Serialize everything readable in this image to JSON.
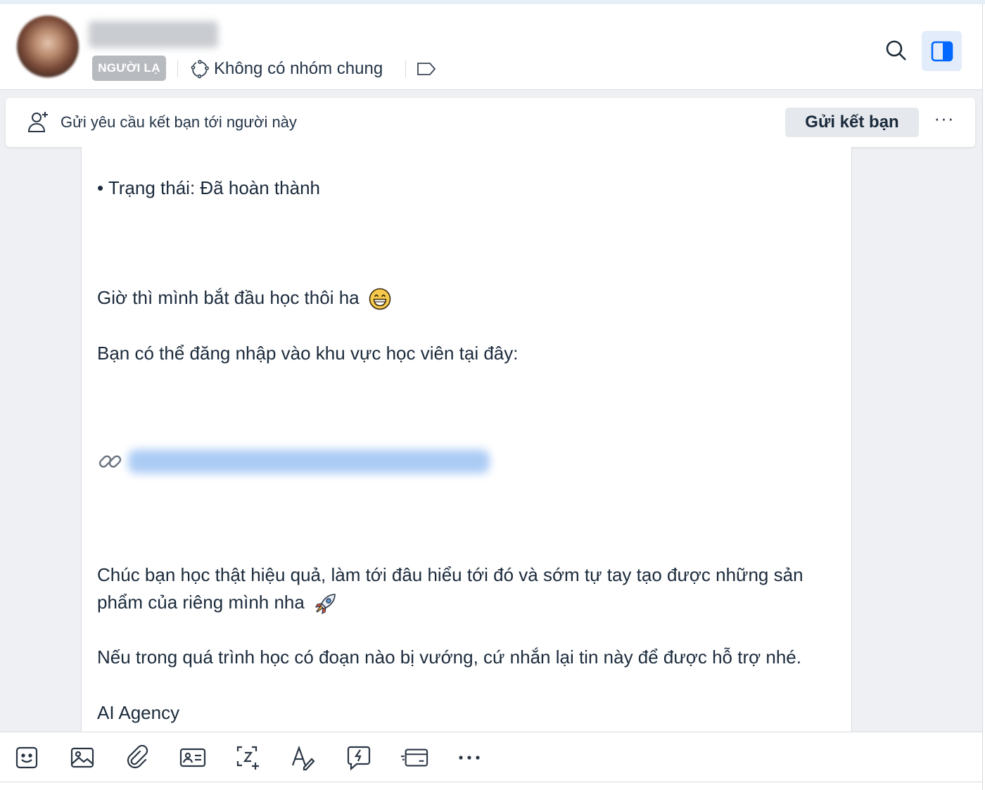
{
  "header": {
    "badge": "NGƯỜI LẠ",
    "groups_text": "Không có nhóm chung"
  },
  "friend_request": {
    "prompt": "Gửi yêu cầu kết bạn tới người này",
    "button": "Gửi kết bạn",
    "more": "···"
  },
  "message": {
    "status_line": "• Trạng thái: Đã hoàn thành",
    "start_line": "Giờ thì mình bắt đầu học thôi ha",
    "login_line": "Bạn có thể đăng nhập vào khu vực học viên tại đây:",
    "wish_line_1": "Chúc bạn học thật hiệu quả, làm tới đâu hiểu tới đó và sớm tự tay tạo được những sản",
    "wish_line_2": "phẩm của riêng mình nha",
    "support_line": "Nếu trong quá trình học có đoạn nào bị vướng, cứ nhắn lại tin này để được hỗ trợ nhé.",
    "signature": "AI Agency"
  },
  "icons": {
    "header": [
      "group-icon",
      "tag-icon",
      "search-icon",
      "side-panel-icon"
    ],
    "friend_request": [
      "add-friend-icon",
      "more-icon"
    ],
    "message": [
      "grinning-emoji-icon",
      "link-icon",
      "rocket-emoji-icon"
    ],
    "toolbar": [
      "sticker-icon",
      "image-icon",
      "attachment-icon",
      "contact-card-icon",
      "screenshot-icon",
      "text-format-icon",
      "quick-message-icon",
      "payment-card-icon",
      "more-icon"
    ]
  },
  "colors": {
    "accent": "#0068ff",
    "badge_bg": "#b7babf",
    "panel_btn_bg": "#e3ecfa",
    "chat_bg": "#eef0f3"
  }
}
